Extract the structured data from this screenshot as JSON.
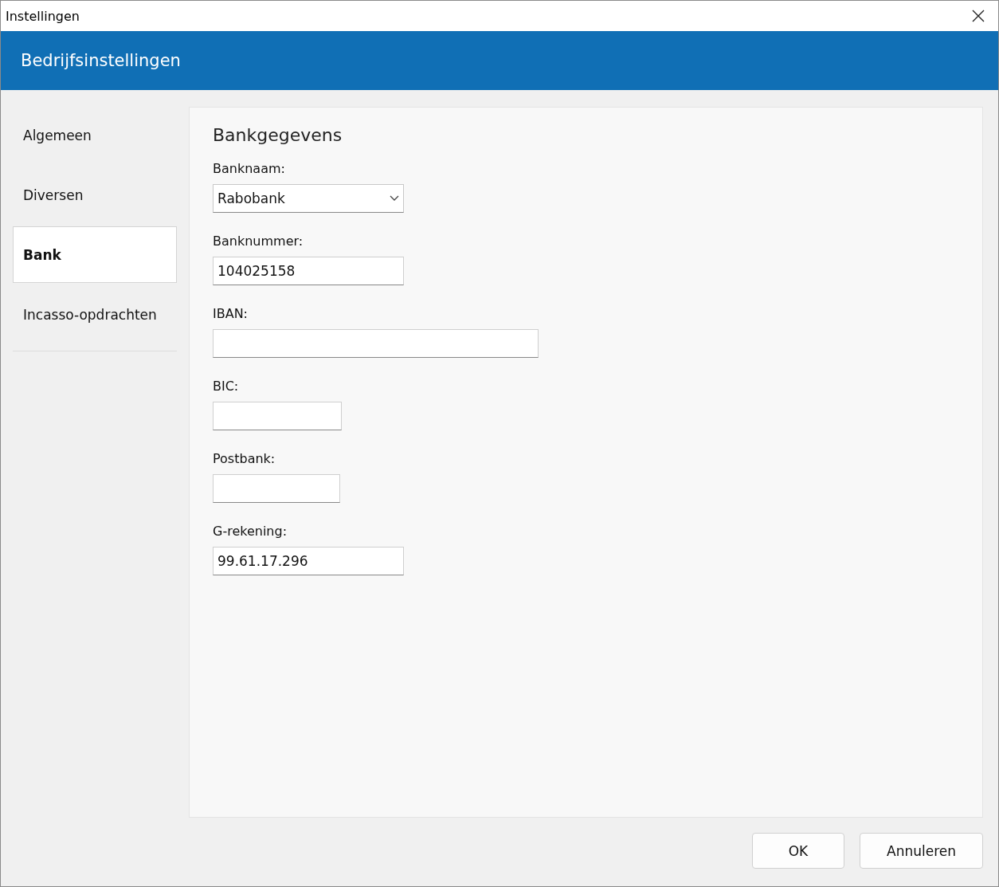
{
  "window": {
    "title": "Instellingen"
  },
  "header": {
    "title": "Bedrijfsinstellingen"
  },
  "sidebar": {
    "items": [
      {
        "label": "Algemeen",
        "selected": false
      },
      {
        "label": "Diversen",
        "selected": false
      },
      {
        "label": "Bank",
        "selected": true
      },
      {
        "label": "Incasso-opdrachten",
        "selected": false
      }
    ]
  },
  "section": {
    "title": "Bankgegevens",
    "fields": [
      {
        "kind": "select",
        "label": "Banknaam:",
        "value": "Rabobank"
      },
      {
        "kind": "text",
        "label": "Banknummer:",
        "value": "104025158"
      },
      {
        "kind": "text",
        "label": "IBAN:"
      },
      {
        "kind": "text",
        "label": "BIC:"
      },
      {
        "kind": "text",
        "label": "Postbank:"
      },
      {
        "kind": "text",
        "label": "G-rekening:",
        "value": "99.61.17.296"
      }
    ]
  },
  "buttons": [
    "OK",
    "Annuleren"
  ]
}
